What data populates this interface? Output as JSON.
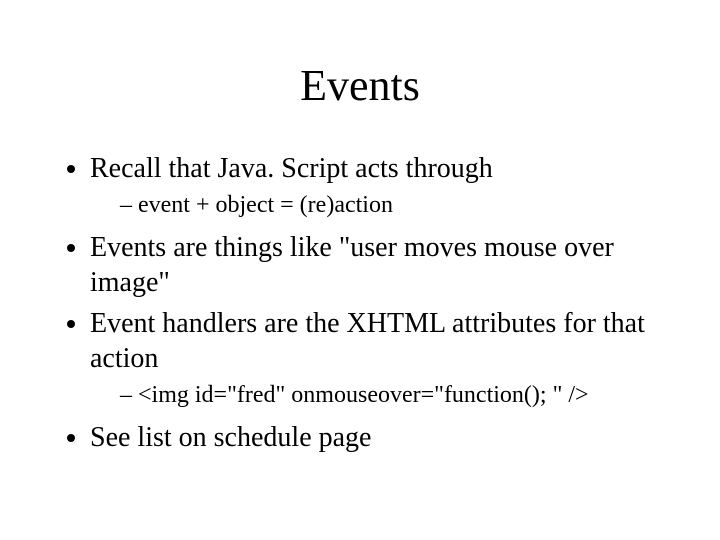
{
  "title": "Events",
  "bullets": {
    "b1": "Recall that Java. Script acts through",
    "b1_sub1": "event + object = (re)action",
    "b2": "Events are things like \"user moves mouse over image\"",
    "b3": "Event handlers are the XHTML attributes for that action",
    "b3_sub1": "<img id=\"fred\" onmouseover=\"function(); \" />",
    "b4": "See list on schedule page"
  }
}
